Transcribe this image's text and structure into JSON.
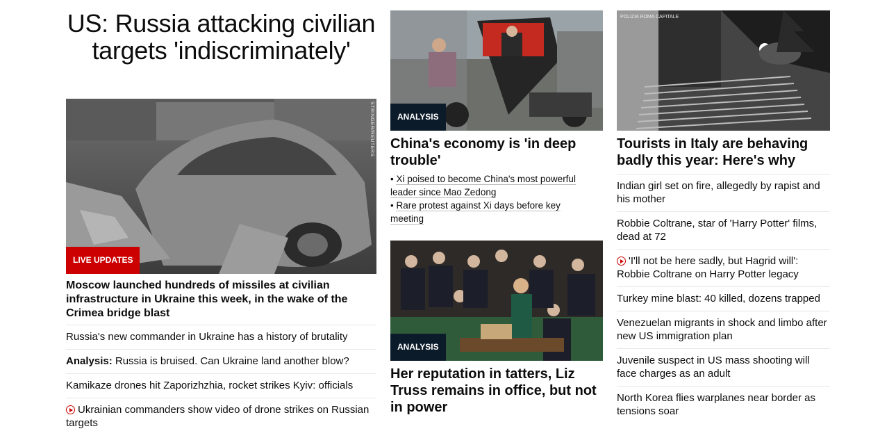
{
  "col1": {
    "headline": "US: Russia attacking civilian targets 'indiscriminately'",
    "image_credit": "STRINGER/REUTERS",
    "badge": "LIVE UPDATES",
    "title": "Moscow launched hundreds of missiles at civilian infrastructure in Ukraine this week, in the wake of the Crimea bridge blast",
    "links": [
      {
        "text": "Russia's new commander in Ukraine has a history of brutality"
      },
      {
        "prefix": "Analysis:",
        "text": " Russia is bruised. Can Ukraine land another blow?"
      },
      {
        "text": "Kamikaze drones hit Zaporizhzhia, rocket strikes Kyiv: officials"
      },
      {
        "text": "Ukrainian commanders show video of drone strikes on Russian targets",
        "icon": "play-icon"
      }
    ]
  },
  "col2": {
    "story1": {
      "badge": "ANALYSIS",
      "title": "China's economy is 'in deep trouble'",
      "bullets": [
        "Xi poised to become China's most powerful leader since Mao Zedong",
        "Rare protest against Xi days before key meeting"
      ]
    },
    "story2": {
      "badge": "ANALYSIS",
      "title": "Her reputation in tatters, Liz Truss remains in office, but not in power"
    }
  },
  "col3": {
    "image_logo": "POLIZIA ROMA CAPITALE",
    "title": "Tourists in Italy are behaving badly this year: Here's why",
    "links": [
      {
        "text": "Indian girl set on fire, allegedly by rapist and his mother"
      },
      {
        "text": "Robbie Coltrane, star of 'Harry Potter' films, dead at 72"
      },
      {
        "text": "'I'll not be here sadly, but Hagrid will': Robbie Coltrane on Harry Potter legacy",
        "icon": "play-icon"
      },
      {
        "text": "Turkey mine blast: 40 killed, dozens trapped"
      },
      {
        "text": "Venezuelan migrants in shock and limbo after new US immigration plan"
      },
      {
        "text": "Juvenile suspect in US mass shooting will face charges as an adult"
      },
      {
        "text": "North Korea flies warplanes near border as tensions soar"
      }
    ]
  },
  "colors": {
    "red": "#cc0000",
    "dark_badge": "#0c1b2a",
    "divider": "#e6e6e6"
  }
}
